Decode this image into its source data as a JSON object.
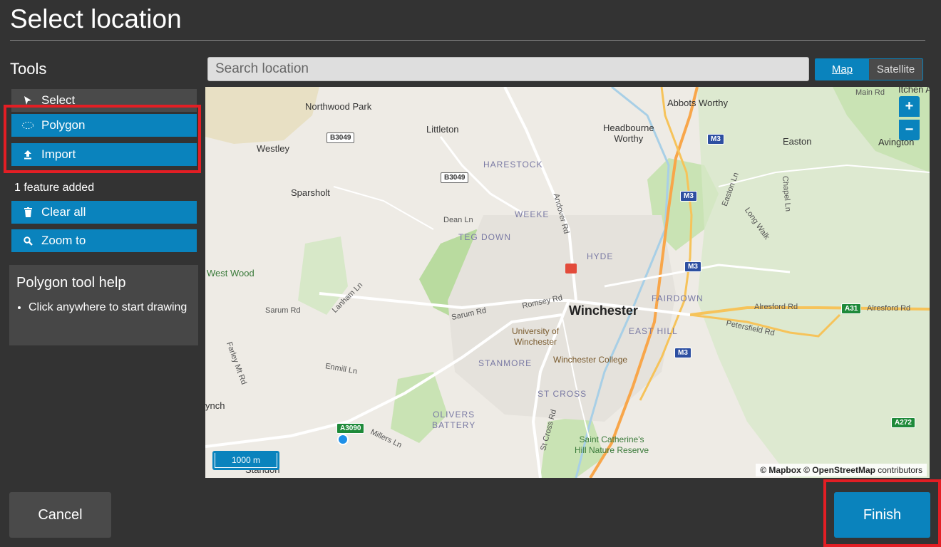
{
  "title": "Select location",
  "tools": {
    "heading": "Tools",
    "select_label": "Select",
    "polygon_label": "Polygon",
    "import_label": "Import",
    "feature_count": "1 feature added",
    "clear_all_label": "Clear all",
    "zoom_to_label": "Zoom to"
  },
  "help": {
    "title": "Polygon tool help",
    "items": [
      "Click anywhere to start drawing"
    ]
  },
  "search": {
    "placeholder": "Search location"
  },
  "map_toggle": {
    "map": "Map",
    "satellite": "Satellite",
    "selected": "Map"
  },
  "map": {
    "labels": {
      "northwood_park": "Northwood Park",
      "littleton": "Littleton",
      "headbourne_worthy": "Headbourne\nWorthy",
      "abbots_worthy": "Abbots Worthy",
      "easton": "Easton",
      "avington": "Avington",
      "itchen": "Itchen A",
      "westley": "Westley",
      "sparsholt": "Sparsholt",
      "west_wood": "West Wood",
      "winchester": "Winchester",
      "ynch": "ynch",
      "standon": "Standon"
    },
    "districts": {
      "harestock": "HARESTOCK",
      "weeke": "WEEKE",
      "teg_down": "TEG DOWN",
      "hyde": "HYDE",
      "fairdown": "FAIRDOWN",
      "east_hill": "EAST HILL",
      "stanmore": "STANMORE",
      "st_cross": "ST CROSS",
      "olivers_battery": "OLIVERS\nBATTERY"
    },
    "roads": {
      "main_rd": "Main Rd",
      "dean_ln": "Dean Ln",
      "andover_rd": "Andover Rd",
      "easton_ln": "Easton Ln",
      "chapel_ln": "Chapel Ln",
      "long_walk": "Long Walk",
      "romsey_rd": "Romsey Rd",
      "sarum_rd_1": "Sarum Rd",
      "sarum_rd_2": "Sarum Rd",
      "lanham_ln": "Lanham Ln",
      "alresford_rd_1": "Alresford Rd",
      "alresford_rd_2": "Alresford Rd",
      "petersfield_rd": "Petersfield Rd",
      "farley_mt_rd": "Farley Mt Rd",
      "enmill_ln": "Enmill Ln",
      "millers_ln": "Millers Ln",
      "st_cross_rd": "St Cross Rd"
    },
    "shields": {
      "b3049_1": "B3049",
      "b3049_2": "B3049",
      "m3_1": "M3",
      "m3_2": "M3",
      "m3_3": "M3",
      "m3_4": "M3",
      "a31": "A31",
      "a3090": "A3090",
      "a272": "A272"
    },
    "places": {
      "university": "University of\nWinchester",
      "college": "Winchester College",
      "st_catherines": "Saint Catherine's\nHill Nature Reserve"
    },
    "scale": "1000 m",
    "zoom_in": "+",
    "zoom_out": "−",
    "attribution": {
      "mapbox": "© Mapbox",
      "osm": "© OpenStreetMap",
      "suffix": "contributors"
    }
  },
  "footer": {
    "cancel_label": "Cancel",
    "finish_label": "Finish"
  },
  "colors": {
    "accent": "#0a83bd",
    "background": "#333333",
    "highlight": "#e31e24"
  }
}
